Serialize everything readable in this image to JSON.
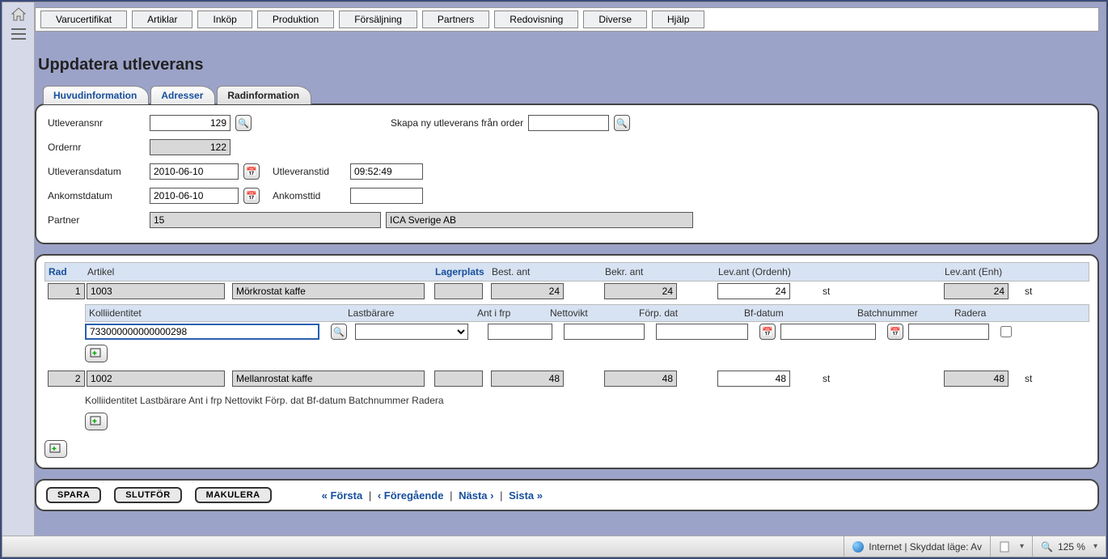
{
  "menu": [
    "Varucertifikat",
    "Artiklar",
    "Inköp",
    "Produktion",
    "Försäljning",
    "Partners",
    "Redovisning",
    "Diverse",
    "Hjälp"
  ],
  "page_title": "Uppdatera utleverans",
  "tabs": {
    "huvud": "Huvudinformation",
    "adresser": "Adresser",
    "rad": "Radinformation"
  },
  "form": {
    "utleveransnr_label": "Utleveransnr",
    "utleveransnr": "129",
    "ordernr_label": "Ordernr",
    "ordernr": "122",
    "utlevdatum_label": "Utleveransdatum",
    "utlevdatum": "2010-06-10",
    "utlevtid_label": "Utleveranstid",
    "utlevtid": "09:52:49",
    "ankdatum_label": "Ankomstdatum",
    "ankdatum": "2010-06-10",
    "anktid_label": "Ankomsttid",
    "anktid": "",
    "partner_label": "Partner",
    "partner_id": "15",
    "partner_name": "ICA Sverige AB",
    "skapa_label": "Skapa ny utleverans från order",
    "skapa_val": ""
  },
  "grid": {
    "headers": {
      "rad": "Rad",
      "artikel": "Artikel",
      "lagerplats": "Lagerplats",
      "best": "Best. ant",
      "bekr": "Bekr. ant",
      "levord": "Lev.ant (Ordenh)",
      "levenh": "Lev.ant (Enh)"
    },
    "sub_headers": {
      "kolli": "Kolliidentitet",
      "lastb": "Lastbärare",
      "antfrp": "Ant i frp",
      "netto": "Nettovikt",
      "forp": "Förp. dat",
      "bf": "Bf-datum",
      "batch": "Batchnummer",
      "radera": "Radera"
    },
    "rows": [
      {
        "rad": "1",
        "art_nr": "1003",
        "art_name": "Mörkrostat kaffe",
        "lagerplats": "",
        "best": "24",
        "bekr": "24",
        "levord": "24",
        "unit1": "st",
        "levenh": "24",
        "unit2": "st",
        "sub": {
          "kolli": "733000000000000298",
          "lastb": "",
          "antfrp": "",
          "netto": "",
          "forp": "",
          "bf": "",
          "batch": "",
          "radera": false
        }
      },
      {
        "rad": "2",
        "art_nr": "1002",
        "art_name": "Mellanrostat kaffe",
        "lagerplats": "",
        "best": "48",
        "bekr": "48",
        "levord": "48",
        "unit1": "st",
        "levenh": "48",
        "unit2": "st"
      }
    ],
    "sub_compact_text": "Kolliidentitet Lastbärare Ant i frp Nettovikt Förp. dat Bf-datum Batchnummer Radera"
  },
  "footer": {
    "spara": "Spara",
    "slutfor": "Slutför",
    "makulera": "Makulera",
    "forsta": "« Första",
    "foreg": "‹ Föregående",
    "nasta": "Nästa ›",
    "sista": "Sista »"
  },
  "status": {
    "zone": "Internet | Skyddat läge: Av",
    "zoom": "125 %"
  }
}
